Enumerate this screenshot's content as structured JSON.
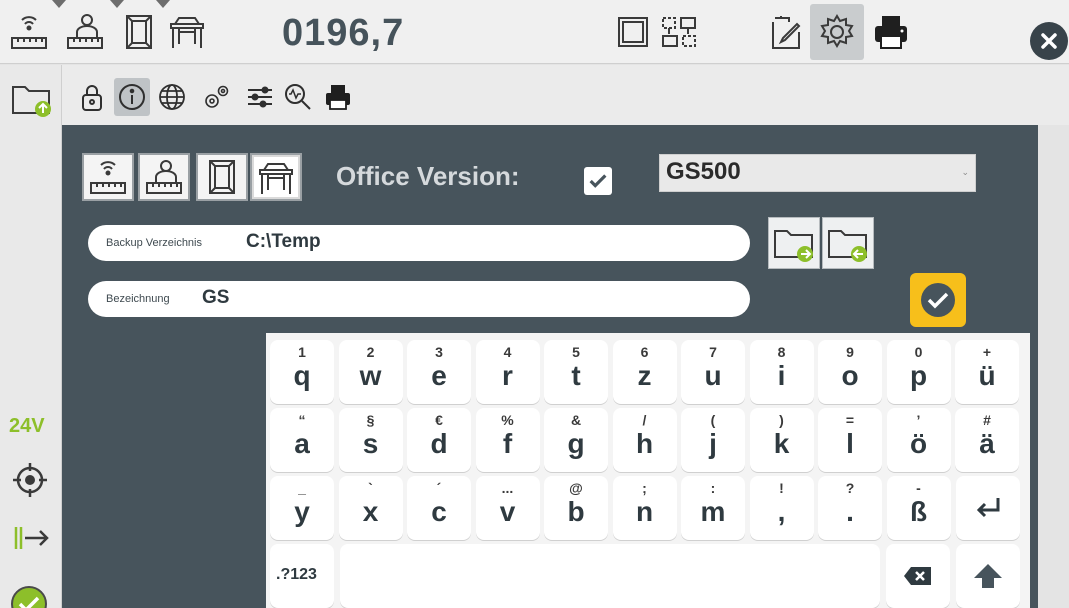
{
  "topbar": {
    "counter": "0196,7",
    "icons": [
      "wireless-ruler-icon",
      "person-ruler-icon",
      "window-frame-icon",
      "table-frame-icon",
      "frame-view-icon",
      "swap-layout-icon",
      "edit-document-icon",
      "settings-gear-icon",
      "printer-icon",
      "close-icon"
    ]
  },
  "sidebar": {
    "voltage": "24V",
    "icons": [
      "folder-upload-icon",
      "crosshair-target-icon",
      "step-forward-icon",
      "ok-check-icon"
    ]
  },
  "toolbar2": {
    "icons": [
      "lock-icon",
      "info-icon",
      "globe-icon",
      "gears-icon",
      "sliders-icon",
      "analysis-search-icon",
      "printer-icon"
    ]
  },
  "settings": {
    "office_version_label": "Office Version:",
    "office_version_checked": true,
    "model": "GS500",
    "backup_label": "Backup Verzeichnis",
    "backup_value": "C:\\Temp",
    "name_label": "Bezeichnung",
    "name_value": "GS"
  },
  "keyboard": {
    "row1": [
      {
        "sec": "1",
        "pri": "q"
      },
      {
        "sec": "2",
        "pri": "w"
      },
      {
        "sec": "3",
        "pri": "e"
      },
      {
        "sec": "4",
        "pri": "r"
      },
      {
        "sec": "5",
        "pri": "t"
      },
      {
        "sec": "6",
        "pri": "z"
      },
      {
        "sec": "7",
        "pri": "u"
      },
      {
        "sec": "8",
        "pri": "i"
      },
      {
        "sec": "9",
        "pri": "o"
      },
      {
        "sec": "0",
        "pri": "p"
      },
      {
        "sec": "+",
        "pri": "ü"
      }
    ],
    "row2": [
      {
        "sec": "“",
        "pri": "a"
      },
      {
        "sec": "§",
        "pri": "s"
      },
      {
        "sec": "€",
        "pri": "d"
      },
      {
        "sec": "%",
        "pri": "f"
      },
      {
        "sec": "&",
        "pri": "g"
      },
      {
        "sec": "/",
        "pri": "h"
      },
      {
        "sec": "(",
        "pri": "j"
      },
      {
        "sec": ")",
        "pri": "k"
      },
      {
        "sec": "=",
        "pri": "l"
      },
      {
        "sec": "’",
        "pri": "ö"
      },
      {
        "sec": "#",
        "pri": "ä"
      }
    ],
    "row3": [
      {
        "sec": "_",
        "pri": "y"
      },
      {
        "sec": "`",
        "pri": "x"
      },
      {
        "sec": "´",
        "pri": "c"
      },
      {
        "sec": "...",
        "pri": "v"
      },
      {
        "sec": "@",
        "pri": "b"
      },
      {
        "sec": ";",
        "pri": "n"
      },
      {
        "sec": ":",
        "pri": "m"
      },
      {
        "sec": "!",
        "pri": ","
      },
      {
        "sec": "?",
        "pri": "."
      },
      {
        "sec": "-",
        "pri": "ß"
      }
    ],
    "mode_key": ".?123",
    "icons": [
      "enter-icon",
      "backspace-icon",
      "shift-icon"
    ]
  }
}
